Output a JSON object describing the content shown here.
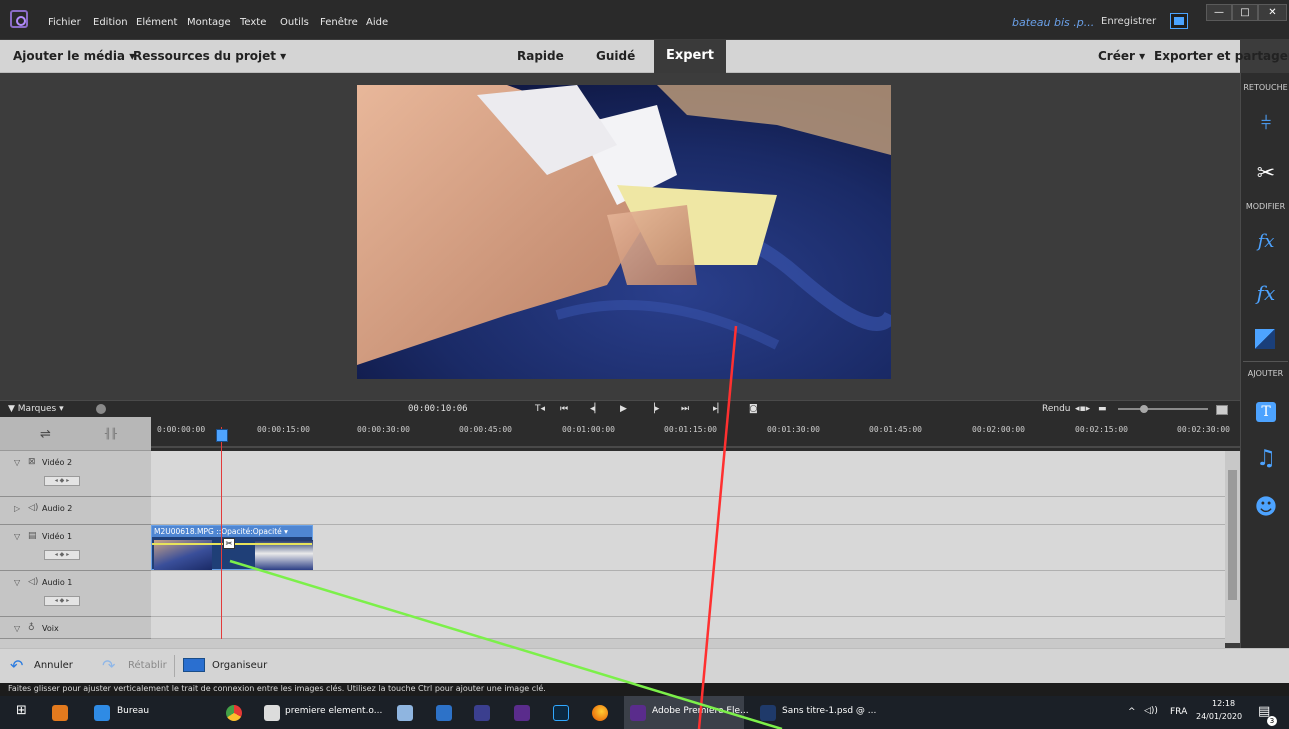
{
  "menubar": {
    "items": [
      "Fichier",
      "Edition",
      "Elément",
      "Montage",
      "Texte",
      "Outils",
      "Fenêtre",
      "Aide"
    ],
    "doc_title": "bateau bis .p...",
    "save_label": "Enregistrer"
  },
  "toolbar": {
    "add_media": "Ajouter le média ▾",
    "project_resources": "Ressources du projet ▾",
    "modes": [
      "Rapide",
      "Guidé",
      "Expert"
    ],
    "create": "Créer ▾",
    "export": "Exporter et partager"
  },
  "right_panel": {
    "retouche": "RETOUCHE",
    "modifier": "MODIFIER",
    "ajouter": "AJOUTER"
  },
  "timeline": {
    "marks_label": "▼ Marques ▾",
    "timecode": "00:00:10:06",
    "render_label": "Rendu",
    "ticks": [
      "0:00:00:00",
      "00:00:15:00",
      "00:00:30:00",
      "00:00:45:00",
      "00:01:00:00",
      "00:01:15:00",
      "00:01:30:00",
      "00:01:45:00",
      "00:02:00:00",
      "00:02:15:00",
      "00:02:30:00"
    ],
    "tracks": [
      "Vidéo 2",
      "Audio 2",
      "Vidéo 1",
      "Audio 1",
      "Voix"
    ],
    "clip_label": "M2U00618.MPG ::Opacité:Opacité ▾"
  },
  "bottom": {
    "undo": "Annuler",
    "redo": "Rétablir",
    "organizer": "Organiseur"
  },
  "status_text": "Faites glisser pour ajuster verticalement le trait de connexion entre les images clés. Utilisez la touche Ctrl pour ajouter une image clé.",
  "taskbar": {
    "desktop": "Bureau",
    "app1": "premiere element.o...",
    "app_active": "Adobe Premiere Ele...",
    "app_psd": "Sans titre-1.psd @ ...",
    "lang": "FRA",
    "time": "12:18",
    "date": "24/01/2020",
    "notif_count": "3"
  },
  "colors": {
    "accent": "#4da3ff",
    "playhead": "#e23b3b",
    "annotation_red": "#ff3030",
    "annotation_green": "#7cf04a"
  }
}
